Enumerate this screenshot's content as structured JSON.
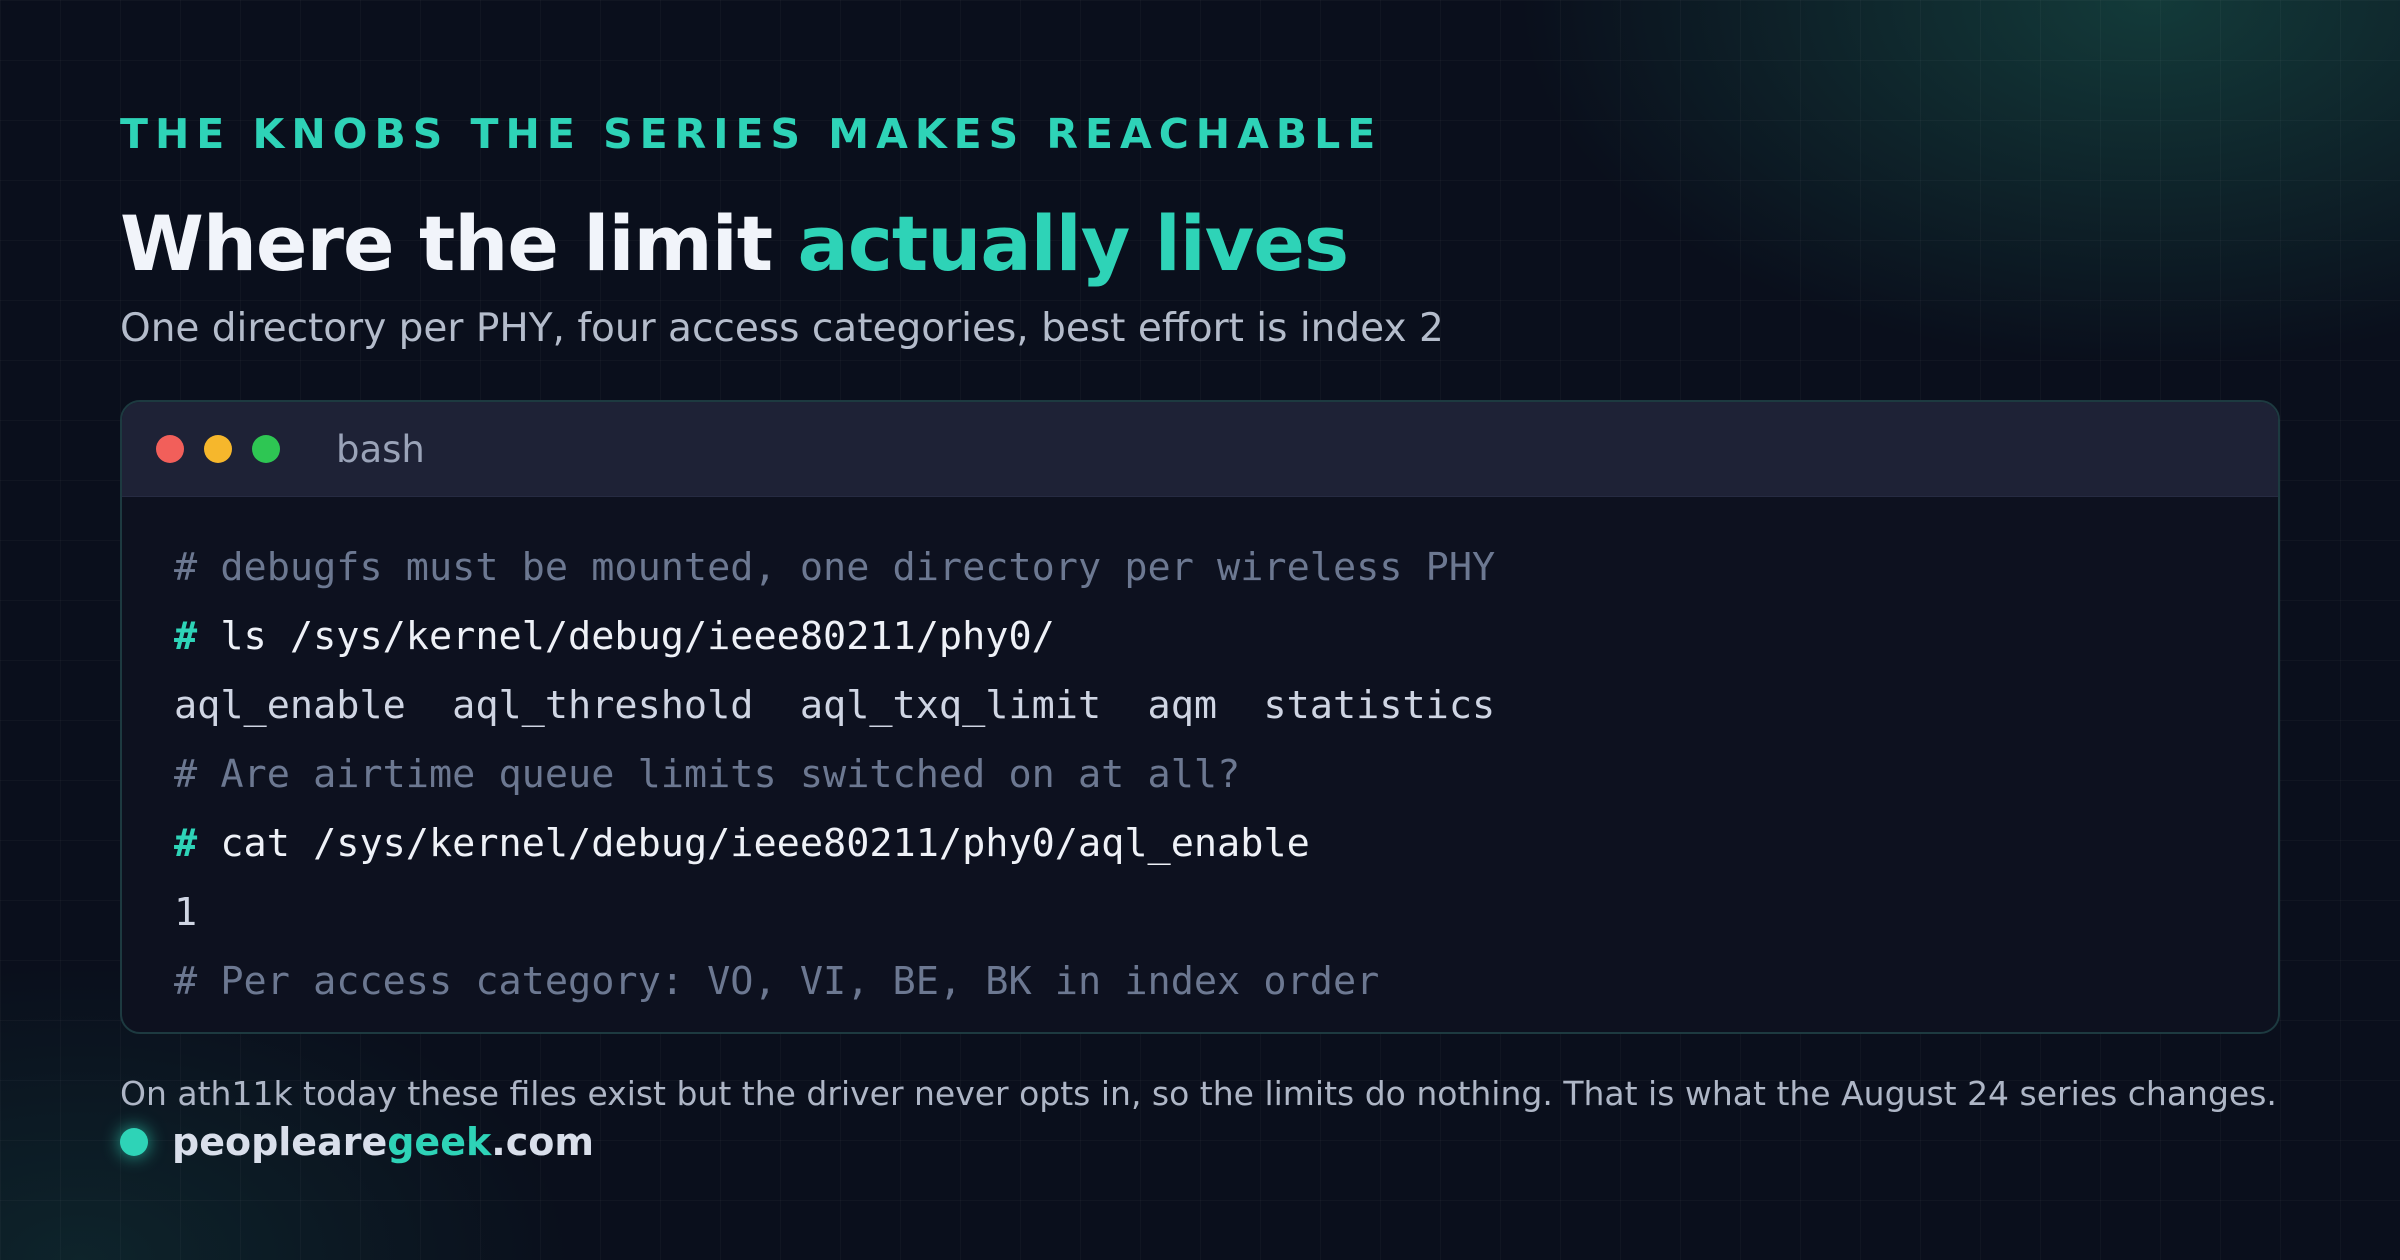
{
  "eyebrow": "THE KNOBS THE SERIES MAKES REACHABLE",
  "title": {
    "main": "Where the limit ",
    "accent": "actually lives"
  },
  "subtitle": "One directory per PHY, four access categories, best effort is index 2",
  "terminal": {
    "label": "bash",
    "lines": [
      {
        "kind": "comment",
        "text": "# debugfs must be mounted, one directory per wireless PHY"
      },
      {
        "kind": "command",
        "prompt": "#",
        "text": " ls /sys/kernel/debug/ieee80211/phy0/"
      },
      {
        "kind": "output",
        "text": "aql_enable  aql_threshold  aql_txq_limit  aqm  statistics"
      },
      {
        "kind": "comment",
        "text": "# Are airtime queue limits switched on at all?"
      },
      {
        "kind": "command",
        "prompt": "#",
        "text": " cat /sys/kernel/debug/ieee80211/phy0/aql_enable"
      },
      {
        "kind": "output",
        "text": "1"
      },
      {
        "kind": "comment",
        "text": "# Per access category: VO, VI, BE, BK in index order"
      }
    ]
  },
  "footnote": "On ath11k today these files exist but the driver never opts in, so the limits do nothing. That is what the August 24 series changes.",
  "brand": {
    "part1": "peopleare",
    "part2": "geek",
    "part3": ".com"
  },
  "colors": {
    "accent": "#2ed3b7",
    "background": "#0a0f1c",
    "terminal_bg": "#0d111f",
    "titlebar_bg": "#1e2236"
  }
}
